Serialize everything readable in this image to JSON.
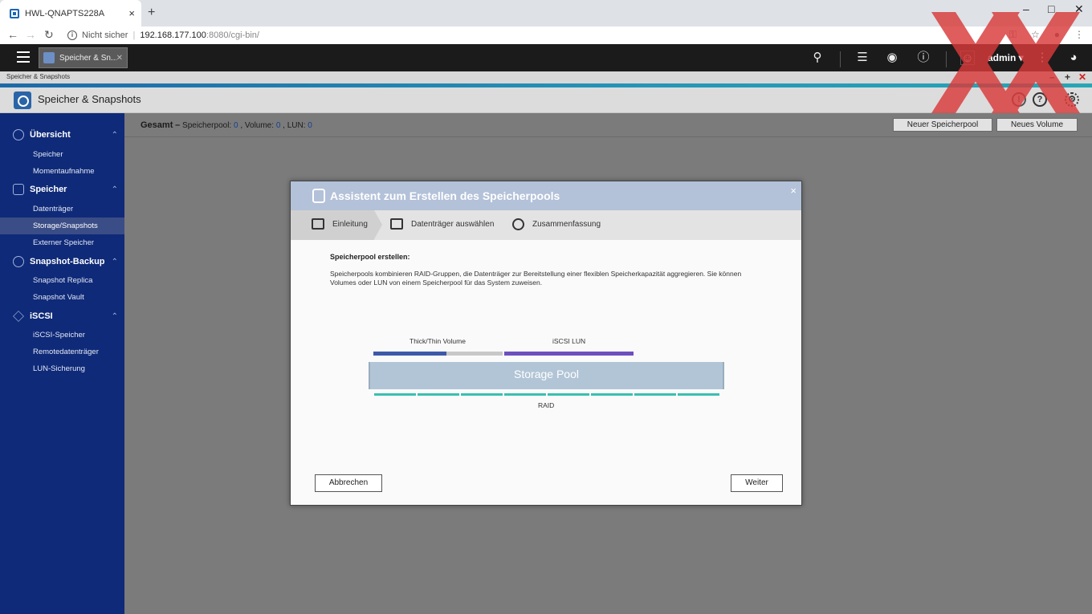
{
  "browser": {
    "tab_title": "HWL-QNAPTS228A",
    "tab_close": "×",
    "new_tab": "+",
    "security_label": "Nicht sicher",
    "url_host": "192.168.177.100",
    "url_path": ":8080/cgi-bin/"
  },
  "topbar": {
    "app_tab_label": "Speicher & Sn...",
    "user_name": "admin ▾"
  },
  "window": {
    "subtitle": "Speicher & Snapshots",
    "app_title": "Speicher & Snapshots"
  },
  "sidebar": {
    "sections": [
      {
        "label": "Übersicht",
        "items": [
          "Speicher",
          "Momentaufnahme"
        ]
      },
      {
        "label": "Speicher",
        "items": [
          "Datenträger",
          "Storage/Snapshots",
          "Externer Speicher"
        ]
      },
      {
        "label": "Snapshot-Backup",
        "items": [
          "Snapshot Replica",
          "Snapshot Vault"
        ]
      },
      {
        "label": "iSCSI",
        "items": [
          "iSCSI-Speicher",
          "Remotedatenträger",
          "LUN-Sicherung"
        ]
      }
    ],
    "active_item": "Storage/Snapshots"
  },
  "summary": {
    "label": "Gesamt",
    "dash": "–",
    "pool_label": "Speicherpool:",
    "pool_count": "0",
    "volume_label": ", Volume:",
    "volume_count": "0",
    "lun_label": ", LUN:",
    "lun_count": "0",
    "new_pool_button": "Neuer Speicherpool",
    "new_volume_button": "Neues Volume"
  },
  "dialog": {
    "title": "Assistent zum Erstellen des Speicherpools",
    "close": "×",
    "steps": [
      "Einleitung",
      "Datenträger auswählen",
      "Zusammenfassung"
    ],
    "active_step": 0,
    "heading": "Speicherpool erstellen:",
    "description": "Speicherpools kombinieren RAID-Gruppen, die Datenträger zur Bereitstellung einer flexiblen Speicherkapazität aggregieren. Sie können Volumes oder LUN von einem Speicherpool für das System zuweisen.",
    "diagram": {
      "volume_label": "Thick/Thin Volume",
      "lun_label": "iSCSI LUN",
      "pool_label": "Storage Pool",
      "raid_label": "RAID",
      "colors": {
        "volume": "#3d5aa8",
        "volume_rest": "#c8c8c8",
        "lun": "#6d4fbe",
        "pool": "#b2c5d6",
        "raid": "#3bbfb1"
      }
    },
    "cancel_button": "Abbrechen",
    "next_button": "Weiter"
  }
}
